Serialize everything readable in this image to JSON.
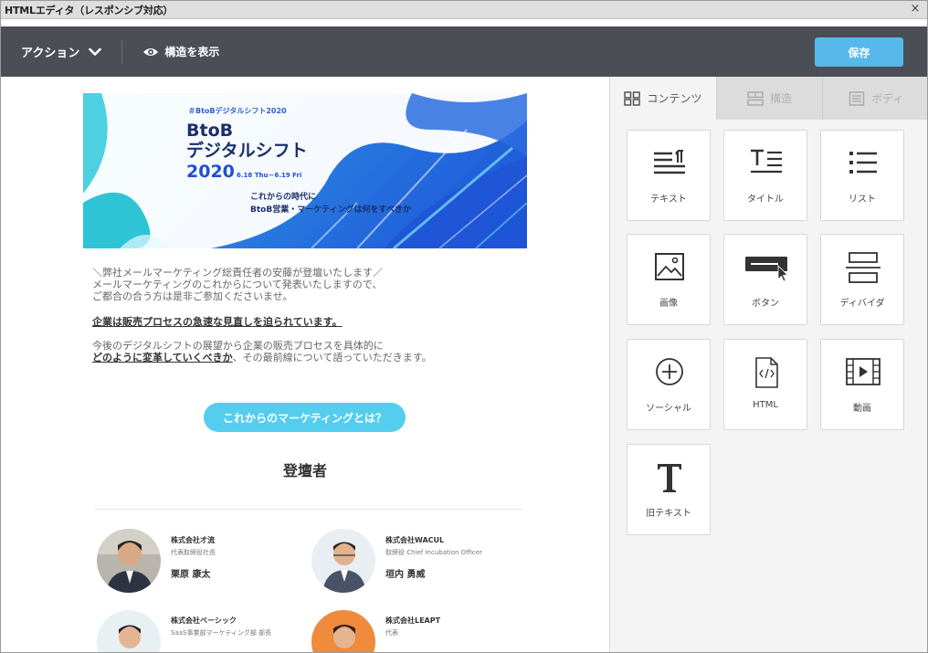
{
  "window": {
    "title": "HTMLエディタ（レスポンシブ対応）",
    "close": "×"
  },
  "toolbar": {
    "action_label": "アクション",
    "view_structure_label": "構造を表示",
    "save_label": "保存"
  },
  "hero": {
    "hashtag": "＃BtoBデジタルシフト2020",
    "line1": "BtoB",
    "line2": "デジタルシフト",
    "year": "2020",
    "dates": "6.18 Thu－6.19 Fri",
    "sub1": "これからの時代に",
    "sub2": "BtoB営業・マーケティングは何をすべきか"
  },
  "content": {
    "p1": "＼弊社メールマーケティング総責任者の安藤が登壇いたします／",
    "p2": "メールマーケティングのこれからについて発表いたしますので、",
    "p3": "ご都合の合う方は是非ご参加くださいませ。",
    "emphasis": "企業は販売プロセスの急速な見直しを迫られています。",
    "p4": "今後のデジタルシフトの展望から企業の販売プロセスを具体的に",
    "p5_underline": "どのように変革していくべきか",
    "p5_rest": "、その最前線について語っていただきます。",
    "cta": "これからのマーケティングとは？",
    "speakers_title": "登壇者"
  },
  "speakers": [
    {
      "company": "株式会社才流",
      "role": "代表取締役社長",
      "name": "栗原 康太"
    },
    {
      "company": "株式会社WACUL",
      "role": "取締役 Chief Incubation Officer",
      "name": "垣内 勇威"
    },
    {
      "company": "株式会社ベーシック",
      "role": "SaaS事業部マーケティング部 部長",
      "name": ""
    },
    {
      "company": "株式会社LEAPT",
      "role": "代表",
      "name": ""
    }
  ],
  "panel": {
    "tabs": [
      {
        "label": "コンテンツ",
        "icon": "grid-icon",
        "active": true
      },
      {
        "label": "構造",
        "icon": "structure-icon",
        "active": false
      },
      {
        "label": "ボディ",
        "icon": "body-icon",
        "active": false
      }
    ],
    "blocks": [
      {
        "label": "テキスト",
        "icon": "text-icon"
      },
      {
        "label": "タイトル",
        "icon": "title-icon"
      },
      {
        "label": "リスト",
        "icon": "list-icon"
      },
      {
        "label": "画像",
        "icon": "image-icon"
      },
      {
        "label": "ボタン",
        "icon": "button-icon"
      },
      {
        "label": "ディバイダ",
        "icon": "divider-icon"
      },
      {
        "label": "ソーシャル",
        "icon": "social-icon"
      },
      {
        "label": "HTML",
        "icon": "html-icon"
      },
      {
        "label": "動画",
        "icon": "video-icon"
      },
      {
        "label": "旧テキスト",
        "icon": "legacy-text-icon"
      }
    ]
  },
  "colors": {
    "toolbar": "#4b4f55",
    "save": "#56b9ea",
    "cta": "#55cdef",
    "panel": "#f4f4f4"
  }
}
